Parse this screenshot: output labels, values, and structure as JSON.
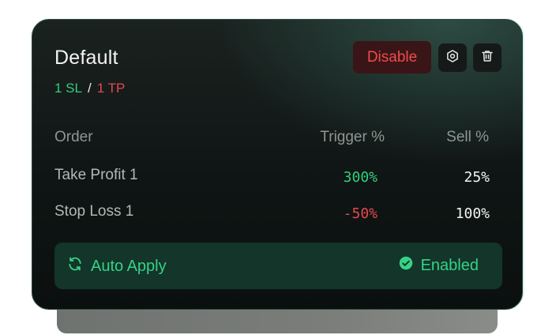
{
  "profile": {
    "title": "Default",
    "sl_label": "1 SL",
    "separator": "/",
    "tp_label": "1 TP"
  },
  "actions": {
    "disable_label": "Disable",
    "settings_icon": "settings-icon",
    "trash_icon": "trash-icon"
  },
  "table": {
    "headers": {
      "order": "Order",
      "trigger": "Trigger %",
      "sell": "Sell %"
    },
    "rows": [
      {
        "order": "Take Profit 1",
        "trigger": "300%",
        "sell": "25%",
        "trigger_color": "#2fcf7f"
      },
      {
        "order": "Stop Loss 1",
        "trigger": "-50%",
        "sell": "100%",
        "trigger_color": "#e5484d"
      }
    ]
  },
  "footer": {
    "auto_apply_label": "Auto Apply",
    "status_label": "Enabled",
    "accent": "#36d286"
  }
}
